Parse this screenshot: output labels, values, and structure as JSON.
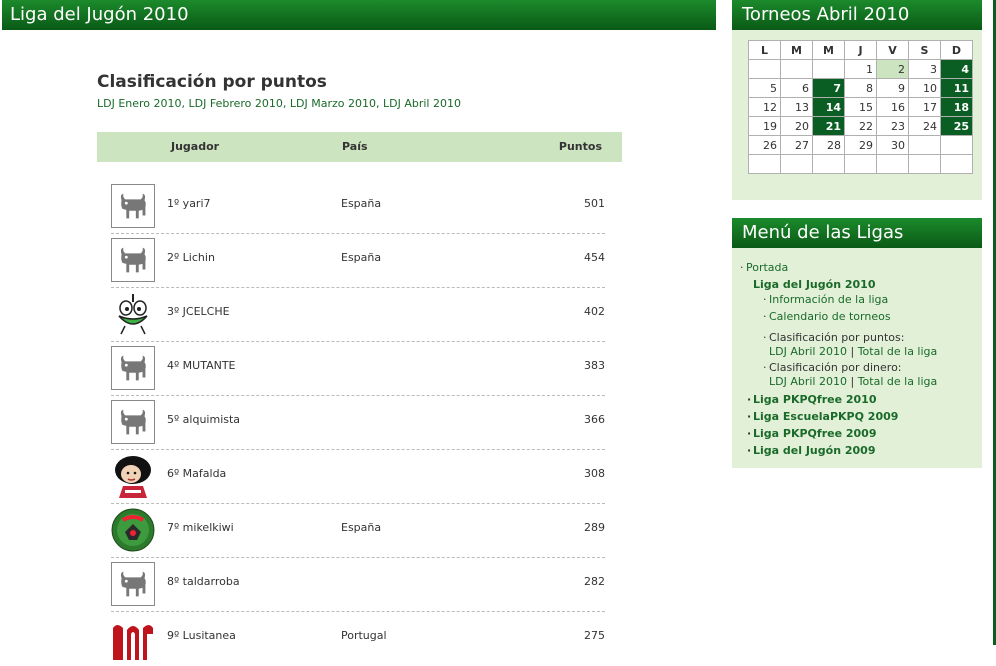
{
  "main": {
    "header_title": "Liga del Jugón 2010",
    "page_title": "Clasificación por puntos",
    "links": [
      "LDJ Enero 2010",
      "LDJ Febrero 2010",
      "LDJ Marzo 2010",
      "LDJ Abril 2010"
    ],
    "table": {
      "headers": [
        "Jugador",
        "País",
        "Puntos"
      ],
      "rows": [
        {
          "name": "1º yari7",
          "country": "España",
          "points": "501",
          "avatar": "bull-icon"
        },
        {
          "name": "2º Lichin",
          "country": "España",
          "points": "454",
          "avatar": "bull-icon"
        },
        {
          "name": "3º JCELCHE",
          "country": "",
          "points": "402",
          "avatar": "cartoon-bird-icon"
        },
        {
          "name": "4º MUTANTE",
          "country": "",
          "points": "383",
          "avatar": "bull-icon"
        },
        {
          "name": "5º alquimista",
          "country": "",
          "points": "366",
          "avatar": "bull-icon"
        },
        {
          "name": "6º Mafalda",
          "country": "",
          "points": "308",
          "avatar": "mafalda-icon"
        },
        {
          "name": "7º mikelkiwi",
          "country": "España",
          "points": "289",
          "avatar": "kiwis-logo-icon"
        },
        {
          "name": "8º taldarroba",
          "country": "",
          "points": "282",
          "avatar": "bull-icon"
        },
        {
          "name": "9º Lusitanea",
          "country": "Portugal",
          "points": "275",
          "avatar": "red-logo-icon"
        }
      ]
    }
  },
  "sidebar": {
    "calendar": {
      "title": "Torneos Abril 2010",
      "weekdays": [
        "L",
        "M",
        "M",
        "J",
        "V",
        "S",
        "D"
      ],
      "weeks": [
        [
          "",
          "",
          "",
          "1",
          "2",
          "3",
          "4"
        ],
        [
          "5",
          "6",
          "7",
          "8",
          "9",
          "10",
          "11"
        ],
        [
          "12",
          "13",
          "14",
          "15",
          "16",
          "17",
          "18"
        ],
        [
          "19",
          "20",
          "21",
          "22",
          "23",
          "24",
          "25"
        ],
        [
          "26",
          "27",
          "28",
          "29",
          "30",
          "",
          ""
        ],
        [
          "",
          "",
          "",
          "",
          "",
          "",
          ""
        ]
      ],
      "highlighted_days": [
        "4",
        "7",
        "11",
        "14",
        "18",
        "21",
        "25"
      ],
      "today": "2"
    },
    "menu": {
      "title": "Menú de las Ligas",
      "portada": "Portada",
      "current_league": "Liga del Jugón 2010",
      "info": "Información de la liga",
      "calendar": "Calendario de torneos",
      "points_label": "Clasificación por puntos:",
      "points_links": [
        "LDJ Abril 2010",
        "Total de la liga"
      ],
      "money_label": "Clasificación por dinero:",
      "money_links": [
        "LDJ Abril 2010",
        "Total de la liga"
      ],
      "other_leagues": [
        "Liga PKPQfree 2010",
        "Liga EscuelaPKPQ 2009",
        "Liga PKPQfree 2009",
        "Liga del Jugón 2009"
      ],
      "separator": "|"
    }
  },
  "colors": {
    "header_green": "#0a5a16",
    "table_head": "#cde4c0",
    "sidebar_bg": "#e2f0d8",
    "calendar_highlight": "#0b5e23",
    "link_green": "#1a6a2a"
  }
}
